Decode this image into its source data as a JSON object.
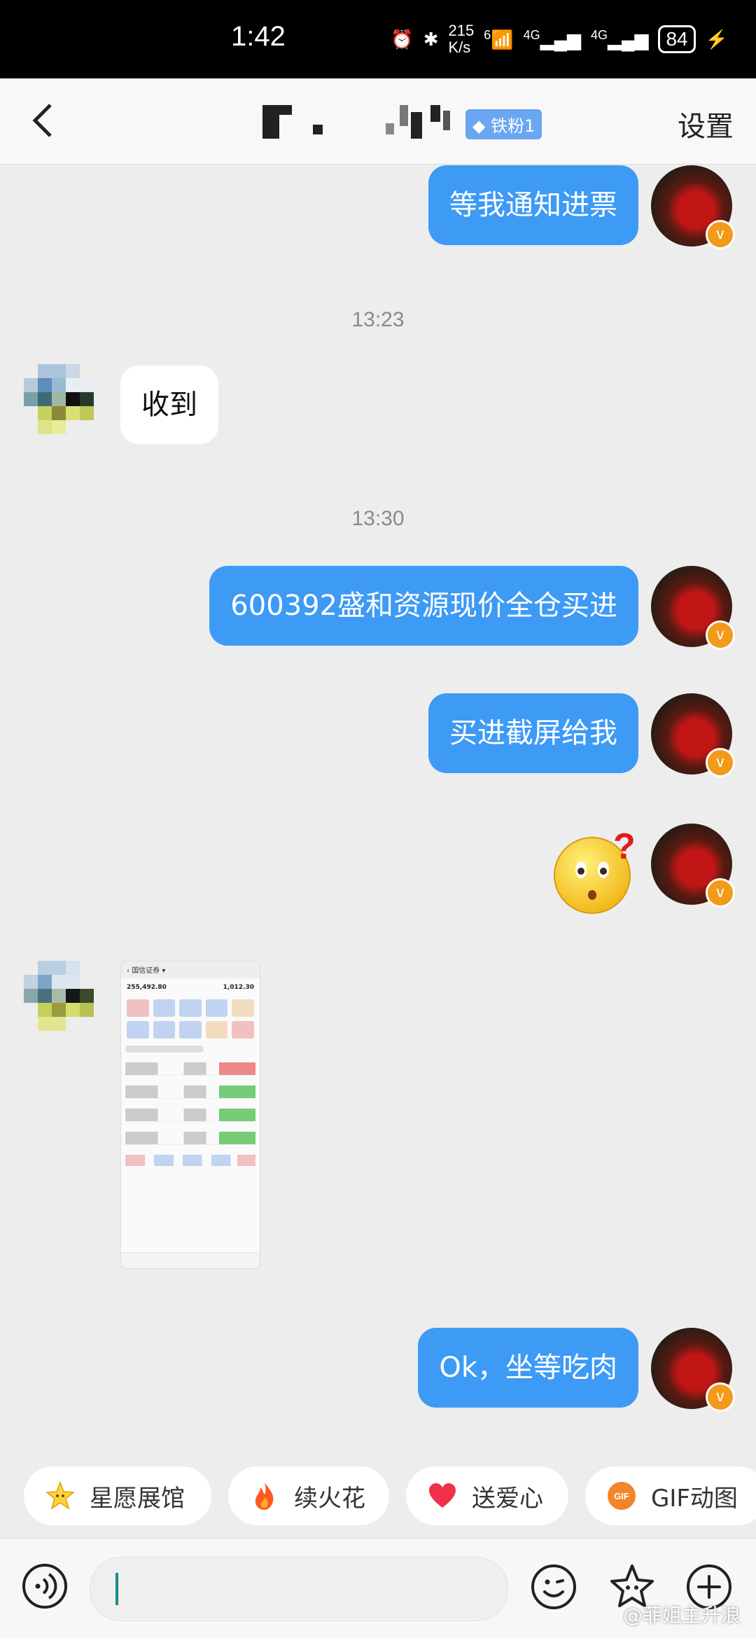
{
  "status_bar": {
    "time": "1:42",
    "net_speed_top": "215",
    "net_speed_bottom": "K/s",
    "wifi_label": "6",
    "signal1_label": "4G",
    "signal2_label": "4G",
    "battery": "84"
  },
  "header": {
    "badge": "铁粉1",
    "settings": "设置"
  },
  "messages": {
    "m1": "等我通知进票",
    "t1": "13:23",
    "m2": "收到",
    "t2": "13:30",
    "m3": "600392盛和资源现价全仓买进",
    "m4": "买进截屏给我",
    "m6": "Ok，坐等吃肉"
  },
  "screenshot_thumb": {
    "app": "国信证券",
    "total_asset": "255,492.80",
    "daily": "1,012.30"
  },
  "quick_actions": [
    {
      "label": "星愿展馆",
      "icon": "star-icon"
    },
    {
      "label": "续火花",
      "icon": "fire-icon"
    },
    {
      "label": "送爱心",
      "icon": "heart-icon"
    },
    {
      "label": "GIF动图",
      "icon": "gif-icon"
    }
  ],
  "watermark": "@菲姐主升浪",
  "colors": {
    "bubble_out": "#3d9af5",
    "bubble_in": "#ffffff",
    "background": "#ededed",
    "vip_badge": "#f29a1a"
  }
}
